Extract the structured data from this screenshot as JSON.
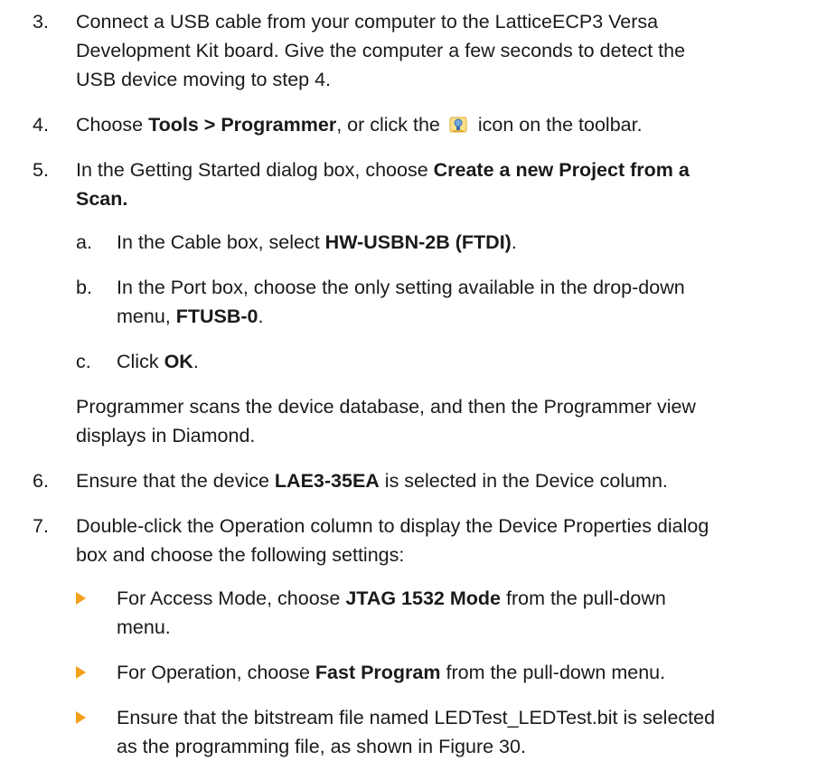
{
  "steps": {
    "s3": {
      "num": "3.",
      "line1": "Connect a USB cable from your computer to the LatticeECP3 Versa",
      "line2": "Development Kit board. Give the computer a few seconds to detect the",
      "line3": "USB device moving to step 4."
    },
    "s4": {
      "num": "4.",
      "pre": "Choose ",
      "bold": "Tools > Programmer",
      "mid": ", or click the",
      "post": "icon on the toolbar.",
      "icon": "programmer-toolbar-icon"
    },
    "s5": {
      "num": "5.",
      "pre": "In the Getting Started dialog box, choose ",
      "bold1": "Create a new Project from a",
      "bold2": "Scan."
    },
    "s5a": {
      "num": "a.",
      "pre": "In the Cable box, select ",
      "bold": "HW-USBN-2B (FTDI)",
      "post": "."
    },
    "s5b": {
      "num": "b.",
      "line1": "In the Port box, choose the only setting available in the drop-down",
      "pre2": "menu, ",
      "bold": "FTUSB-0",
      "post": "."
    },
    "s5c": {
      "num": "c.",
      "pre": "Click ",
      "bold": "OK",
      "post": "."
    },
    "s5note": {
      "line1": "Programmer scans the device database, and then the Programmer view",
      "line2": "displays in Diamond."
    },
    "s6": {
      "num": "6.",
      "pre": "Ensure that the device ",
      "bold": "LAE3-35EA",
      "post": " is selected in the Device column."
    },
    "s7": {
      "num": "7.",
      "line1": "Double-click the Operation column to display the Device Properties dialog",
      "line2": "box and choose the following settings:"
    },
    "b1": {
      "pre": "For Access Mode, choose ",
      "bold": "JTAG 1532 Mode",
      "post": " from the pull-down",
      "line2": "menu."
    },
    "b2": {
      "pre": "For Operation, choose ",
      "bold": "Fast Program",
      "post": " from the pull-down menu."
    },
    "b3": {
      "line1": "Ensure that the bitstream file named LEDTest_LEDTest.bit is selected",
      "line2": "as the programming file, as shown in Figure 30."
    }
  },
  "colors": {
    "bullet": "#f5a01a",
    "text": "#1a1a1a"
  }
}
